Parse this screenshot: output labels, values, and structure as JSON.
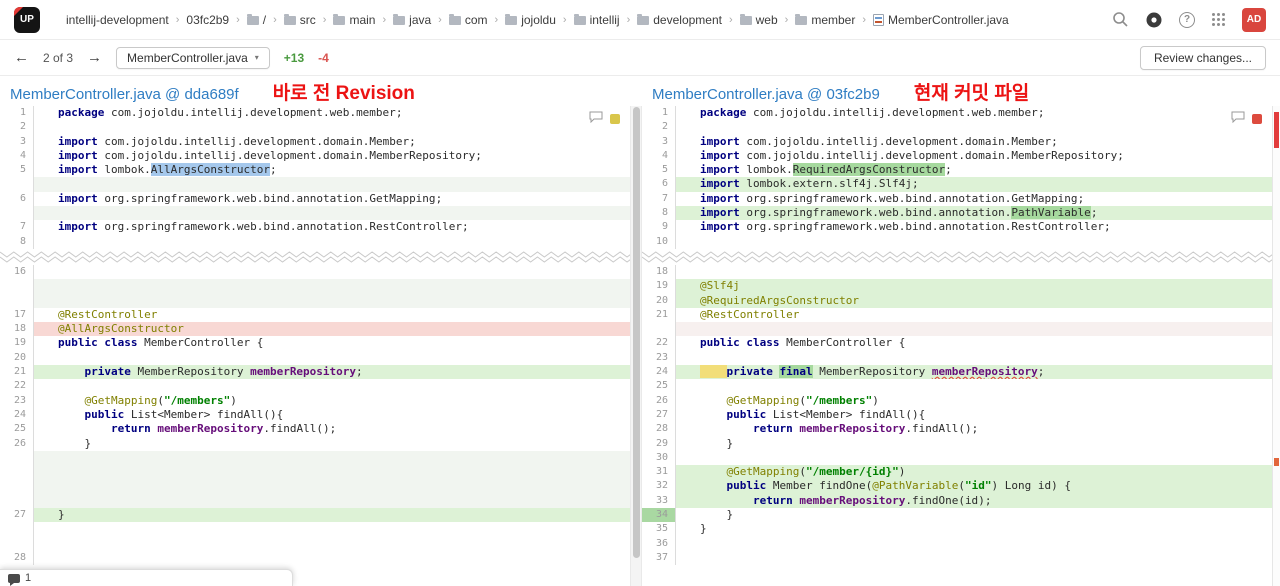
{
  "topbar": {
    "logo": "UP",
    "avatar": "AD",
    "breadcrumb": [
      {
        "label": "intellij-development",
        "icon": null
      },
      {
        "label": "03fc2b9",
        "icon": null
      },
      {
        "label": "/",
        "icon": "folder"
      },
      {
        "label": "src",
        "icon": "folder"
      },
      {
        "label": "main",
        "icon": "folder"
      },
      {
        "label": "java",
        "icon": "folder"
      },
      {
        "label": "com",
        "icon": "folder"
      },
      {
        "label": "jojoldu",
        "icon": "folder"
      },
      {
        "label": "intellij",
        "icon": "folder"
      },
      {
        "label": "development",
        "icon": "folder"
      },
      {
        "label": "web",
        "icon": "folder"
      },
      {
        "label": "member",
        "icon": "folder"
      },
      {
        "label": "MemberController.java",
        "icon": "java-file"
      }
    ]
  },
  "toolbar": {
    "position": "2 of 3",
    "file_selector": "MemberController.java",
    "added": "+13",
    "removed": "-4",
    "review": "Review changes..."
  },
  "headers": {
    "left": {
      "file": "MemberController.java @ dda689f",
      "note": "바로 전 Revision"
    },
    "right": {
      "file": "MemberController.java @ 03fc2b9",
      "note": "현재 커밋 파일"
    }
  },
  "popup": {
    "count": "1"
  },
  "colors": {
    "header_file_blue": "#2f7dc3",
    "annotation_red": "#ec1313",
    "added_line_bg": "#ddf2d6",
    "removed_line_bg": "#f8d8d4",
    "changed_line_bg": "#ddf2d6",
    "filler_add_bg": "#f1f5f0",
    "filler_del_bg": "#f7f0ef",
    "word_removed_bg": "#a5c8ec",
    "word_added_bg": "#a6d99e",
    "indent_marker_yellow": "#f2de79",
    "gutter_added_bg": "#a9d8a2",
    "keyword": "#000080",
    "string": "#008000",
    "annotation": "#808000",
    "field": "#660e7a",
    "avatar_bg": "#d9463e",
    "left_pane_marker": "#d9c64b",
    "right_pane_marker": "#dd4b3e",
    "stripe_marker_red": "#e23c3c",
    "stripe_marker_orange": "#e2663c"
  },
  "diff": {
    "rows": [
      {
        "l": {
          "n": 1,
          "t": "package com.jojoldu.intellij.development.web.member;"
        },
        "r": {
          "n": 1,
          "t": "package com.jojoldu.intellij.development.web.member;"
        }
      },
      {
        "l": {
          "n": 2,
          "t": ""
        },
        "r": {
          "n": 2,
          "t": ""
        }
      },
      {
        "l": {
          "n": 3,
          "t": "import com.jojoldu.intellij.development.domain.Member;"
        },
        "r": {
          "n": 3,
          "t": "import com.jojoldu.intellij.development.domain.Member;"
        }
      },
      {
        "l": {
          "n": 4,
          "t": "import com.jojoldu.intellij.development.domain.MemberRepository;"
        },
        "r": {
          "n": 4,
          "t": "import com.jojoldu.intellij.development.domain.MemberRepository;"
        }
      },
      {
        "l": {
          "n": 5,
          "t": "import lombok.AllArgsConstructor;",
          "mk": [
            {
              "t": "AllArgsConstructor",
              "c": "blue"
            }
          ]
        },
        "r": {
          "n": 5,
          "t": "import lombok.RequiredArgsConstructor;",
          "mk": [
            {
              "t": "RequiredArgsConstructor",
              "c": "green"
            }
          ]
        }
      },
      {
        "l": {
          "fill": "add"
        },
        "r": {
          "n": 6,
          "t": "import lombok.extern.slf4j.Slf4j;",
          "bg": "add"
        }
      },
      {
        "l": {
          "n": 6,
          "t": "import org.springframework.web.bind.annotation.GetMapping;"
        },
        "r": {
          "n": 7,
          "t": "import org.springframework.web.bind.annotation.GetMapping;"
        }
      },
      {
        "l": {
          "fill": "add"
        },
        "r": {
          "n": 8,
          "t": "import org.springframework.web.bind.annotation.PathVariable;",
          "bg": "add",
          "mk": [
            {
              "t": "PathVariable",
              "c": "green"
            }
          ]
        }
      },
      {
        "l": {
          "n": 7,
          "t": "import org.springframework.web.bind.annotation.RestController;"
        },
        "r": {
          "n": 9,
          "t": "import org.springframework.web.bind.annotation.RestController;"
        }
      },
      {
        "l": {
          "n": 8,
          "t": ""
        },
        "r": {
          "n": 10,
          "t": ""
        }
      },
      {
        "type": "sep"
      },
      {
        "l": {
          "n": 16,
          "t": ""
        },
        "r": {
          "n": 18,
          "t": ""
        }
      },
      {
        "l": {
          "fill": "add"
        },
        "r": {
          "n": 19,
          "t": "@Slf4j",
          "bg": "add"
        }
      },
      {
        "l": {
          "fill": "add"
        },
        "r": {
          "n": 20,
          "t": "@RequiredArgsConstructor",
          "bg": "add"
        }
      },
      {
        "l": {
          "n": 17,
          "t": "@RestController"
        },
        "r": {
          "n": 21,
          "t": "@RestController"
        }
      },
      {
        "l": {
          "n": 18,
          "t": "@AllArgsConstructor",
          "bg": "del"
        },
        "r": {
          "fill": "del"
        }
      },
      {
        "l": {
          "n": 19,
          "t": "public class MemberController {"
        },
        "r": {
          "n": 22,
          "t": "public class MemberController {"
        }
      },
      {
        "l": {
          "n": 20,
          "t": ""
        },
        "r": {
          "n": 23,
          "t": ""
        }
      },
      {
        "l": {
          "n": 21,
          "t": "    private MemberRepository memberRepository;",
          "bg": "chg"
        },
        "r": {
          "n": 24,
          "t": "    private final MemberRepository memberRepository;",
          "bg": "chg",
          "chip": "yellow",
          "mk": [
            {
              "t": "final",
              "c": "green"
            },
            {
              "t": "memberRepository",
              "c": "err"
            }
          ]
        }
      },
      {
        "l": {
          "n": 22,
          "t": ""
        },
        "r": {
          "n": 25,
          "t": ""
        }
      },
      {
        "l": {
          "n": 23,
          "t": "    @GetMapping(\"/members\")"
        },
        "r": {
          "n": 26,
          "t": "    @GetMapping(\"/members\")"
        }
      },
      {
        "l": {
          "n": 24,
          "t": "    public List<Member> findAll(){"
        },
        "r": {
          "n": 27,
          "t": "    public List<Member> findAll(){"
        }
      },
      {
        "l": {
          "n": 25,
          "t": "        return memberRepository.findAll();"
        },
        "r": {
          "n": 28,
          "t": "        return memberRepository.findAll();"
        }
      },
      {
        "l": {
          "n": 26,
          "t": "    }"
        },
        "r": {
          "n": 29,
          "t": "    }"
        }
      },
      {
        "l": {
          "fill": "add"
        },
        "r": {
          "n": 30,
          "t": ""
        }
      },
      {
        "l": {
          "fill": "add"
        },
        "r": {
          "n": 31,
          "t": "    @GetMapping(\"/member/{id}\")",
          "bg": "add"
        }
      },
      {
        "l": {
          "fill": "add"
        },
        "r": {
          "n": 32,
          "t": "    public Member findOne(@PathVariable(\"id\") Long id) {",
          "bg": "add"
        }
      },
      {
        "l": {
          "fill": "add"
        },
        "r": {
          "n": 33,
          "t": "        return memberRepository.findOne(id);",
          "bg": "add"
        }
      },
      {
        "l": {
          "n": 27,
          "t": "}",
          "bg": "chg"
        },
        "r": {
          "n": 34,
          "t": "    }",
          "gut": "add"
        }
      },
      {
        "l": {
          "fill": "none"
        },
        "r": {
          "n": 35,
          "t": "}"
        }
      },
      {
        "l": {
          "fill": "none"
        },
        "r": {
          "n": 36,
          "t": ""
        }
      },
      {
        "l": {
          "n": 28,
          "t": ""
        },
        "r": {
          "n": 37,
          "t": ""
        }
      }
    ]
  }
}
